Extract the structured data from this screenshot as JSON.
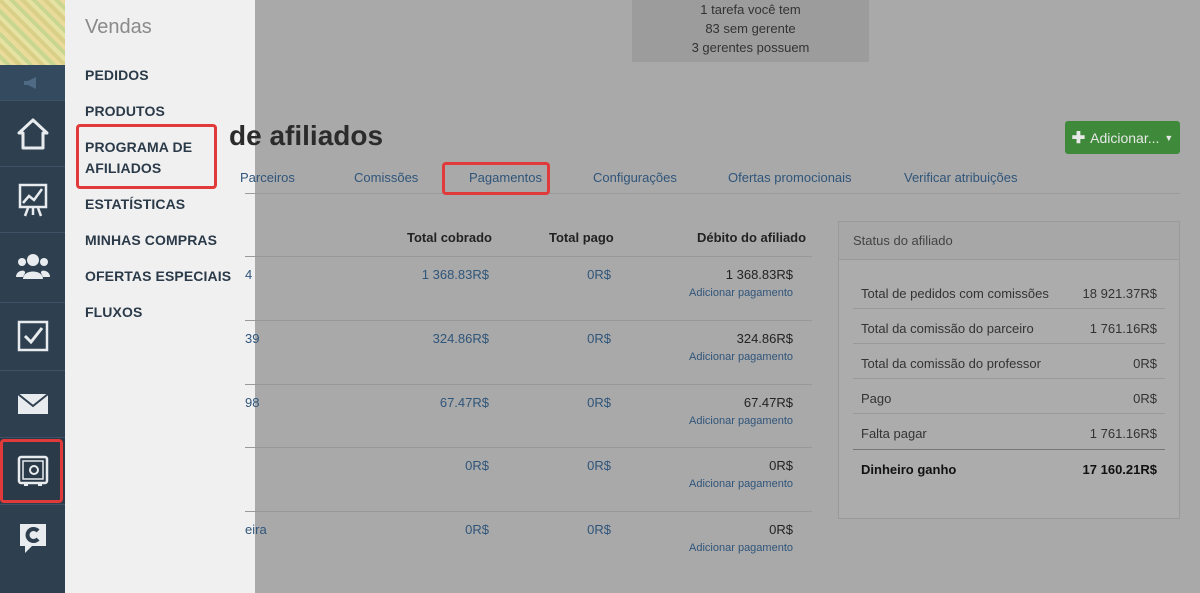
{
  "flyout": {
    "title": "Vendas",
    "items": [
      {
        "label": "PEDIDOS"
      },
      {
        "label": "PRODUTOS"
      },
      {
        "label": "PROGRAMA DE AFILIADOS",
        "line1": "PROGRAMA DE",
        "line2": "AFILIADOS"
      },
      {
        "label": "ESTATÍSTICAS"
      },
      {
        "label": "MINHAS COMPRAS"
      },
      {
        "label": "OFERTAS ESPECIAIS"
      },
      {
        "label": "FLUXOS"
      }
    ]
  },
  "notice": {
    "line1": "1 tarefa você tem",
    "line2": "83 sem gerente",
    "line3": "3 gerentes possuem"
  },
  "page": {
    "title": "de afiliados",
    "add_button": "Adicionar..."
  },
  "tabs": [
    {
      "label": "Parceiros"
    },
    {
      "label": "Comissões"
    },
    {
      "label": "Pagamentos"
    },
    {
      "label": "Configurações"
    },
    {
      "label": "Ofertas promocionais"
    },
    {
      "label": "Verificar atribuições"
    }
  ],
  "table": {
    "headers": {
      "total_charged": "Total cobrado",
      "total_paid": "Total pago",
      "debt": "Débito do afiliado"
    },
    "action_label": "Adicionar pagamento",
    "rows": [
      {
        "left_fragment": "4",
        "total_charged": "1 368.83R$",
        "total_paid": "0R$",
        "debt": "1 368.83R$"
      },
      {
        "left_fragment": "39",
        "total_charged": "324.86R$",
        "total_paid": "0R$",
        "debt": "324.86R$"
      },
      {
        "left_fragment": "98",
        "total_charged": "67.47R$",
        "total_paid": "0R$",
        "debt": "67.47R$"
      },
      {
        "left_fragment": "",
        "total_charged": "0R$",
        "total_paid": "0R$",
        "debt": "0R$"
      },
      {
        "left_fragment": "eira",
        "total_charged": "0R$",
        "total_paid": "0R$",
        "debt": "0R$"
      }
    ]
  },
  "status": {
    "title": "Status do afiliado",
    "rows": [
      {
        "label": "Total de pedidos com comissões",
        "value": "18 921.37R$"
      },
      {
        "label": "Total da comissão do parceiro",
        "value": "1 761.16R$"
      },
      {
        "label": "Total da comissão do professor",
        "value": "0R$"
      },
      {
        "label": "Pago",
        "value": "0R$"
      },
      {
        "label": "Falta pagar",
        "value": "1 761.16R$"
      },
      {
        "label": "Dinheiro ganho",
        "value": "17 160.21R$"
      }
    ]
  },
  "rail": {
    "icons": [
      "megaphone-icon",
      "home-icon",
      "chart-icon",
      "users-icon",
      "checkbox-icon",
      "mail-icon",
      "safe-icon",
      "chat-c-icon"
    ]
  }
}
